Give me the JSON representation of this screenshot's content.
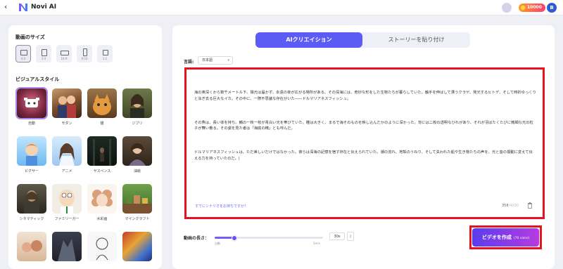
{
  "header": {
    "back_icon": "chevron-left-icon",
    "title": "Novi AI",
    "coins": "10000",
    "avatar_initial": "B"
  },
  "left_panel": {
    "size_title": "動画のサイズ",
    "sizes": [
      {
        "label": "4:3",
        "selected": true
      },
      {
        "label": "3:4",
        "selected": false
      },
      {
        "label": "16:9",
        "selected": false
      },
      {
        "label": "9:16",
        "selected": false
      },
      {
        "label": "1:1",
        "selected": false
      }
    ],
    "style_title": "ビジュアルスタイル",
    "styles": [
      {
        "label": "自動",
        "selected": true
      },
      {
        "label": "モダン",
        "selected": false
      },
      {
        "label": "猫",
        "selected": false
      },
      {
        "label": "ジブリ",
        "selected": false
      },
      {
        "label": "ピクサー",
        "selected": false
      },
      {
        "label": "アニメ",
        "selected": false
      },
      {
        "label": "サスペンス",
        "selected": false
      },
      {
        "label": "油絵",
        "selected": false
      },
      {
        "label": "シネマティック",
        "selected": false
      },
      {
        "label": "ファミリーガー",
        "selected": false
      },
      {
        "label": "水彩画",
        "selected": false
      },
      {
        "label": "マインクラフト",
        "selected": false
      },
      {
        "label": "",
        "selected": false
      },
      {
        "label": "",
        "selected": false
      },
      {
        "label": "",
        "selected": false
      },
      {
        "label": "",
        "selected": false
      }
    ]
  },
  "main": {
    "tabs": [
      {
        "label": "AIクリエイション",
        "active": true
      },
      {
        "label": "ストーリーを貼り付け",
        "active": false
      }
    ],
    "language_label": "言語:",
    "language_value": "日本語",
    "editor_paragraphs": [
      "海の奥深くから数千メートル下、陽光は届かず、永遠の夜が広がる場所がある。その深海には、奇妙な形をした生物たちが暮らしていた。触手を伸ばして漂うクラゲ、発光するヒトデ、そして時折ゆっくりと泳ぎ去る巨大なイカ。その中に、一際不思議な存在がいた――ドルマリアネスフィッシュ。",
      "その魚は、長い体を持ち、鱗の一枚一枚が青白い光を帯びていた。瞳は大きく、まるで海そのものを映し込んだかのように深かった。背には二枚の透明なひれがあり、それが羽ばたくたびに微細な光の粒子が舞い散る。その姿を見た者は「海底の精」とも呼んだ。",
      "ドルマリアネスフィッシュは、ただ美しいだけではなかった。彼らは深海の記憶を宿す存在と伝えられていた。潮の流れ、地殻のうねり、そして失われた船や生き物たちの声を、光と音の振動に変えて伝える力を持っていたのだ。|"
    ],
    "hint_link": "すでにシナリオをお持ちですか？",
    "char_count": "358",
    "char_max": "/4000",
    "length_label": "動画の長さ：",
    "slider_min_label": "自動",
    "slider_max_label": "5min",
    "slider_fraction": 0.18,
    "duration_value": "30s",
    "create_button_label": "ビデオを作成",
    "create_button_cost": "(70 coins)"
  },
  "colors": {
    "accent": "#5b5cf6",
    "highlight_border": "#e5141f"
  }
}
